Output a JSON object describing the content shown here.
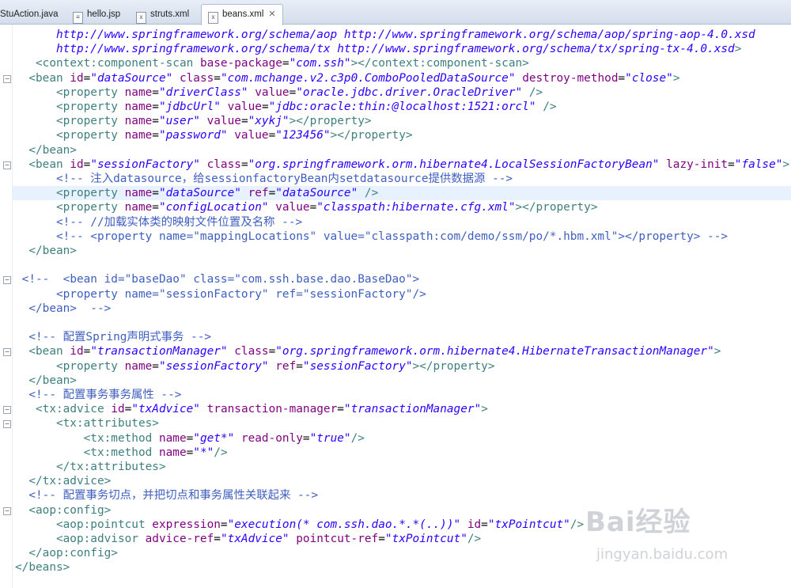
{
  "tabs": [
    {
      "label": "StuAction.java",
      "icon": "java-file-icon",
      "active": false
    },
    {
      "label": "hello.jsp",
      "icon": "jsp-file-icon",
      "active": false
    },
    {
      "label": "struts.xml",
      "icon": "xml-file-icon",
      "active": false
    },
    {
      "label": "beans.xml",
      "icon": "xml-file-icon",
      "active": true
    }
  ],
  "code_lines": [
    {
      "indent": "      ",
      "parts": [
        {
          "c": "v",
          "t": "http://www.springframework.org/schema/aop http://www.springframework.org/schema/aop/spring-aop-4.0.xsd"
        }
      ]
    },
    {
      "indent": "      ",
      "parts": [
        {
          "c": "v",
          "t": "http://www.springframework.org/schema/tx http://www.springframework.org/schema/tx/spring-tx-4.0.xsd"
        },
        {
          "c": "t",
          "t": ">"
        }
      ]
    },
    {
      "indent": "   ",
      "parts": [
        {
          "c": "t",
          "t": "<context:component-scan "
        },
        {
          "c": "a",
          "t": "base-package"
        },
        {
          "c": "",
          "t": "="
        },
        {
          "c": "v",
          "t": "\"com.ssh\""
        },
        {
          "c": "t",
          "t": "></context:component-scan>"
        }
      ]
    },
    {
      "indent": "  ",
      "fold": true,
      "parts": [
        {
          "c": "t",
          "t": "<bean "
        },
        {
          "c": "a",
          "t": "id"
        },
        {
          "c": "",
          "t": "="
        },
        {
          "c": "v",
          "t": "\"dataSource\""
        },
        {
          "c": "",
          "t": " "
        },
        {
          "c": "a",
          "t": "class"
        },
        {
          "c": "",
          "t": "="
        },
        {
          "c": "v",
          "t": "\"com.mchange.v2.c3p0.ComboPooledDataSource\""
        },
        {
          "c": "",
          "t": " "
        },
        {
          "c": "a",
          "t": "destroy-method"
        },
        {
          "c": "",
          "t": "="
        },
        {
          "c": "v",
          "t": "\"close\""
        },
        {
          "c": "t",
          "t": ">"
        }
      ]
    },
    {
      "indent": "      ",
      "parts": [
        {
          "c": "t",
          "t": "<property "
        },
        {
          "c": "a",
          "t": "name"
        },
        {
          "c": "",
          "t": "="
        },
        {
          "c": "v",
          "t": "\"driverClass\""
        },
        {
          "c": "",
          "t": " "
        },
        {
          "c": "a",
          "t": "value"
        },
        {
          "c": "",
          "t": "="
        },
        {
          "c": "v",
          "t": "\"oracle.jdbc.driver.OracleDriver\""
        },
        {
          "c": "",
          "t": " "
        },
        {
          "c": "t",
          "t": "/>"
        }
      ]
    },
    {
      "indent": "      ",
      "parts": [
        {
          "c": "t",
          "t": "<property "
        },
        {
          "c": "a",
          "t": "name"
        },
        {
          "c": "",
          "t": "="
        },
        {
          "c": "v",
          "t": "\"jdbcUrl\""
        },
        {
          "c": "",
          "t": " "
        },
        {
          "c": "a",
          "t": "value"
        },
        {
          "c": "",
          "t": "="
        },
        {
          "c": "v",
          "t": "\"jdbc:oracle:thin:@localhost:1521:orcl\""
        },
        {
          "c": "",
          "t": " "
        },
        {
          "c": "t",
          "t": "/>"
        }
      ]
    },
    {
      "indent": "      ",
      "parts": [
        {
          "c": "t",
          "t": "<property "
        },
        {
          "c": "a",
          "t": "name"
        },
        {
          "c": "",
          "t": "="
        },
        {
          "c": "v",
          "t": "\"user\""
        },
        {
          "c": "",
          "t": " "
        },
        {
          "c": "a",
          "t": "value"
        },
        {
          "c": "",
          "t": "="
        },
        {
          "c": "v",
          "t": "\"xykj\""
        },
        {
          "c": "t",
          "t": "></property>"
        }
      ]
    },
    {
      "indent": "      ",
      "parts": [
        {
          "c": "t",
          "t": "<property "
        },
        {
          "c": "a",
          "t": "name"
        },
        {
          "c": "",
          "t": "="
        },
        {
          "c": "v",
          "t": "\"password\""
        },
        {
          "c": "",
          "t": " "
        },
        {
          "c": "a",
          "t": "value"
        },
        {
          "c": "",
          "t": "="
        },
        {
          "c": "v",
          "t": "\"123456\""
        },
        {
          "c": "t",
          "t": "></property>"
        }
      ]
    },
    {
      "indent": "  ",
      "parts": [
        {
          "c": "t",
          "t": "</bean>"
        }
      ]
    },
    {
      "indent": "  ",
      "fold": true,
      "parts": [
        {
          "c": "t",
          "t": "<bean "
        },
        {
          "c": "a",
          "t": "id"
        },
        {
          "c": "",
          "t": "="
        },
        {
          "c": "v",
          "t": "\"sessionFactory\""
        },
        {
          "c": "",
          "t": " "
        },
        {
          "c": "a",
          "t": "class"
        },
        {
          "c": "",
          "t": "="
        },
        {
          "c": "v",
          "t": "\"org.springframework.orm.hibernate4.LocalSessionFactoryBean\""
        },
        {
          "c": "",
          "t": " "
        },
        {
          "c": "a",
          "t": "lazy-init"
        },
        {
          "c": "",
          "t": "="
        },
        {
          "c": "v",
          "t": "\"false\""
        },
        {
          "c": "t",
          "t": ">"
        }
      ]
    },
    {
      "indent": "      ",
      "parts": [
        {
          "c": "c",
          "t": "<!-- 注入datasource，给sessionfactoryBean内setdatasource提供数据源 -->"
        }
      ]
    },
    {
      "indent": "      ",
      "current": true,
      "parts": [
        {
          "c": "t",
          "t": "<property "
        },
        {
          "c": "a",
          "t": "name"
        },
        {
          "c": "",
          "t": "="
        },
        {
          "c": "v",
          "t": "\"dataSource\""
        },
        {
          "c": "",
          "t": " "
        },
        {
          "c": "a",
          "t": "ref"
        },
        {
          "c": "",
          "t": "="
        },
        {
          "c": "v",
          "t": "\"dataSource\""
        },
        {
          "c": "",
          "t": " "
        },
        {
          "c": "t",
          "t": "/>"
        }
      ]
    },
    {
      "indent": "      ",
      "parts": [
        {
          "c": "t",
          "t": "<property "
        },
        {
          "c": "a",
          "t": "name"
        },
        {
          "c": "",
          "t": "="
        },
        {
          "c": "v",
          "t": "\"configLocation\""
        },
        {
          "c": "",
          "t": " "
        },
        {
          "c": "a",
          "t": "value"
        },
        {
          "c": "",
          "t": "="
        },
        {
          "c": "v",
          "t": "\"classpath:hibernate.cfg.xml\""
        },
        {
          "c": "t",
          "t": "></property>"
        }
      ]
    },
    {
      "indent": "      ",
      "parts": [
        {
          "c": "c",
          "t": "<!-- //加载实体类的映射文件位置及名称 -->"
        }
      ]
    },
    {
      "indent": "      ",
      "parts": [
        {
          "c": "c",
          "t": "<!-- <property name=\"mappingLocations\" value=\"classpath:com/demo/ssm/po/*.hbm.xml\"></property> -->"
        }
      ]
    },
    {
      "indent": "  ",
      "parts": [
        {
          "c": "t",
          "t": "</bean>"
        }
      ]
    },
    {
      "indent": "",
      "parts": []
    },
    {
      "indent": " ",
      "fold": true,
      "parts": [
        {
          "c": "c",
          "t": "<!--  <bean id=\"baseDao\" class=\"com.ssh.base.dao.BaseDao\">"
        }
      ]
    },
    {
      "indent": "      ",
      "parts": [
        {
          "c": "c",
          "t": "<property name=\"sessionFactory\" ref=\"sessionFactory\"/>"
        }
      ]
    },
    {
      "indent": "  ",
      "parts": [
        {
          "c": "c",
          "t": "</bean>  -->"
        }
      ]
    },
    {
      "indent": "",
      "parts": []
    },
    {
      "indent": "  ",
      "parts": [
        {
          "c": "c",
          "t": "<!-- 配置Spring声明式事务 -->"
        }
      ]
    },
    {
      "indent": "  ",
      "fold": true,
      "parts": [
        {
          "c": "t",
          "t": "<bean "
        },
        {
          "c": "a",
          "t": "id"
        },
        {
          "c": "",
          "t": "="
        },
        {
          "c": "v",
          "t": "\"transactionManager\""
        },
        {
          "c": "",
          "t": " "
        },
        {
          "c": "a",
          "t": "class"
        },
        {
          "c": "",
          "t": "="
        },
        {
          "c": "v",
          "t": "\"org.springframework.orm.hibernate4.HibernateTransactionManager\""
        },
        {
          "c": "t",
          "t": ">"
        }
      ]
    },
    {
      "indent": "      ",
      "parts": [
        {
          "c": "t",
          "t": "<property "
        },
        {
          "c": "a",
          "t": "name"
        },
        {
          "c": "",
          "t": "="
        },
        {
          "c": "v",
          "t": "\"sessionFactory\""
        },
        {
          "c": "",
          "t": " "
        },
        {
          "c": "a",
          "t": "ref"
        },
        {
          "c": "",
          "t": "="
        },
        {
          "c": "v",
          "t": "\"sessionFactory\""
        },
        {
          "c": "t",
          "t": "></property>"
        }
      ]
    },
    {
      "indent": "  ",
      "parts": [
        {
          "c": "t",
          "t": "</bean>"
        }
      ]
    },
    {
      "indent": "  ",
      "parts": [
        {
          "c": "c",
          "t": "<!-- 配置事务事务属性 -->"
        }
      ]
    },
    {
      "indent": "   ",
      "fold": true,
      "parts": [
        {
          "c": "t",
          "t": "<tx:advice "
        },
        {
          "c": "a",
          "t": "id"
        },
        {
          "c": "",
          "t": "="
        },
        {
          "c": "v",
          "t": "\"txAdvice\""
        },
        {
          "c": "",
          "t": " "
        },
        {
          "c": "a",
          "t": "transaction-manager"
        },
        {
          "c": "",
          "t": "="
        },
        {
          "c": "v",
          "t": "\"transactionManager\""
        },
        {
          "c": "t",
          "t": ">"
        }
      ]
    },
    {
      "indent": "      ",
      "fold": true,
      "parts": [
        {
          "c": "t",
          "t": "<tx:attributes>"
        }
      ]
    },
    {
      "indent": "          ",
      "parts": [
        {
          "c": "t",
          "t": "<tx:method "
        },
        {
          "c": "a",
          "t": "name"
        },
        {
          "c": "",
          "t": "="
        },
        {
          "c": "v",
          "t": "\"get*\""
        },
        {
          "c": "",
          "t": " "
        },
        {
          "c": "a",
          "t": "read-only"
        },
        {
          "c": "",
          "t": "="
        },
        {
          "c": "v",
          "t": "\"true\""
        },
        {
          "c": "t",
          "t": "/>"
        }
      ]
    },
    {
      "indent": "          ",
      "parts": [
        {
          "c": "t",
          "t": "<tx:method "
        },
        {
          "c": "a",
          "t": "name"
        },
        {
          "c": "",
          "t": "="
        },
        {
          "c": "v",
          "t": "\"*\""
        },
        {
          "c": "t",
          "t": "/>"
        }
      ]
    },
    {
      "indent": "      ",
      "parts": [
        {
          "c": "t",
          "t": "</tx:attributes>"
        }
      ]
    },
    {
      "indent": "  ",
      "parts": [
        {
          "c": "t",
          "t": "</tx:advice>"
        }
      ]
    },
    {
      "indent": "  ",
      "parts": [
        {
          "c": "c",
          "t": "<!-- 配置事务切点，并把切点和事务属性关联起来 -->"
        }
      ]
    },
    {
      "indent": "  ",
      "fold": true,
      "parts": [
        {
          "c": "t",
          "t": "<aop:config>"
        }
      ]
    },
    {
      "indent": "      ",
      "parts": [
        {
          "c": "t",
          "t": "<aop:pointcut "
        },
        {
          "c": "a",
          "t": "expression"
        },
        {
          "c": "",
          "t": "="
        },
        {
          "c": "v",
          "t": "\"execution(* com.ssh.dao.*.*(..))\""
        },
        {
          "c": "",
          "t": " "
        },
        {
          "c": "a",
          "t": "id"
        },
        {
          "c": "",
          "t": "="
        },
        {
          "c": "v",
          "t": "\"txPointcut\""
        },
        {
          "c": "t",
          "t": "/>"
        }
      ]
    },
    {
      "indent": "      ",
      "parts": [
        {
          "c": "t",
          "t": "<aop:advisor "
        },
        {
          "c": "a",
          "t": "advice-ref"
        },
        {
          "c": "",
          "t": "="
        },
        {
          "c": "v",
          "t": "\"txAdvice\""
        },
        {
          "c": "",
          "t": " "
        },
        {
          "c": "a",
          "t": "pointcut-ref"
        },
        {
          "c": "",
          "t": "="
        },
        {
          "c": "v",
          "t": "\"txPointcut\""
        },
        {
          "c": "t",
          "t": "/>"
        }
      ]
    },
    {
      "indent": "  ",
      "parts": [
        {
          "c": "t",
          "t": "</aop:config>"
        }
      ]
    },
    {
      "indent": "",
      "parts": [
        {
          "c": "t",
          "t": "</beans>"
        }
      ]
    }
  ],
  "watermark": {
    "brand": "Bai经验",
    "url": "jingyan.baidu.com",
    "icon": "baidu-paw-icon"
  },
  "colors": {
    "tag": "#3f7f7f",
    "attribute": "#7f007f",
    "value": "#2a00ff",
    "comment": "#3f5fbf",
    "current_line": "#e8f2fe"
  }
}
